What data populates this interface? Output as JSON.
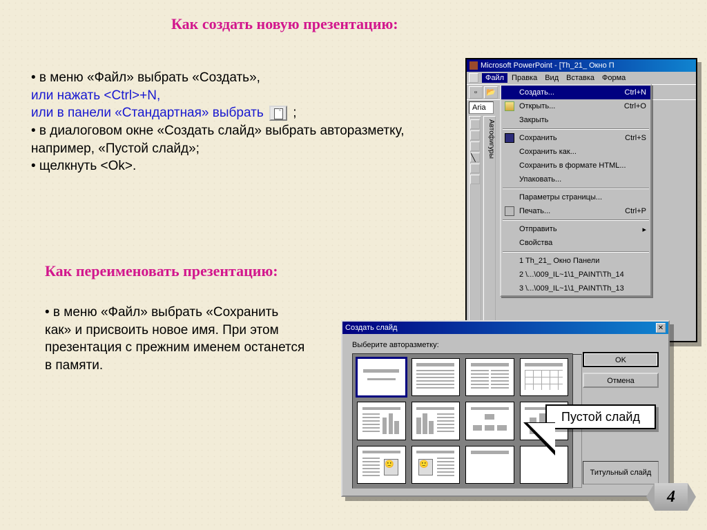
{
  "title1": "Как создать новую презентацию:",
  "title2": "Как переименовать презентацию:",
  "b1": {
    "l1": "• в меню «Файл» выбрать «Создать»,",
    "l2": "или нажать <Ctrl>+N,",
    "l3a": "или  в панели «Стандартная» выбрать",
    "l3b": ";",
    "l4": "• в диалоговом окне «Создать слайд» выбрать авторазметку, например, «Пустой слайд»;",
    "l5": "• щелкнуть <Ok>."
  },
  "b2": "• в меню «Файл» выбрать «Сохранить как» и присвоить новое имя. При этом презентация с прежним именем останется в памяти.",
  "page": "4",
  "pp": {
    "title": "Microsoft PowerPoint - [Th_21_ Окно П",
    "menus": [
      "Файл",
      "Правка",
      "Вид",
      "Вставка",
      "Форма"
    ],
    "font": "Aria",
    "vlabel": "Автофигуры",
    "fileMenu": [
      {
        "label": "Создать...",
        "sc": "Ctrl+N",
        "sel": true
      },
      {
        "label": "Открыть...",
        "sc": "Ctrl+O",
        "icon": "folder"
      },
      {
        "label": "Закрыть"
      },
      {
        "sep": true
      },
      {
        "label": "Сохранить",
        "sc": "Ctrl+S",
        "icon": "save"
      },
      {
        "label": "Сохранить как..."
      },
      {
        "label": "Сохранить в формате HTML..."
      },
      {
        "label": "Упаковать..."
      },
      {
        "sep": true
      },
      {
        "label": "Параметры страницы..."
      },
      {
        "label": "Печать...",
        "sc": "Ctrl+P",
        "icon": "print"
      },
      {
        "sep": true
      },
      {
        "label": "Отправить",
        "arrow": true
      },
      {
        "label": "Свойства"
      },
      {
        "sep": true
      },
      {
        "label": "1 Th_21_ Окно Панели"
      },
      {
        "label": "2 \\...\\009_IL~1\\1_PAINT\\Th_14"
      },
      {
        "label": "3 \\...\\009_IL~1\\1_PAINT\\Th_13"
      }
    ]
  },
  "dlg": {
    "title": "Создать слайд",
    "prompt": "Выберите авторазметку:",
    "ok": "OK",
    "cancel": "Отмена",
    "caption": "Титульный слайд"
  },
  "callout": "Пустой слайд"
}
